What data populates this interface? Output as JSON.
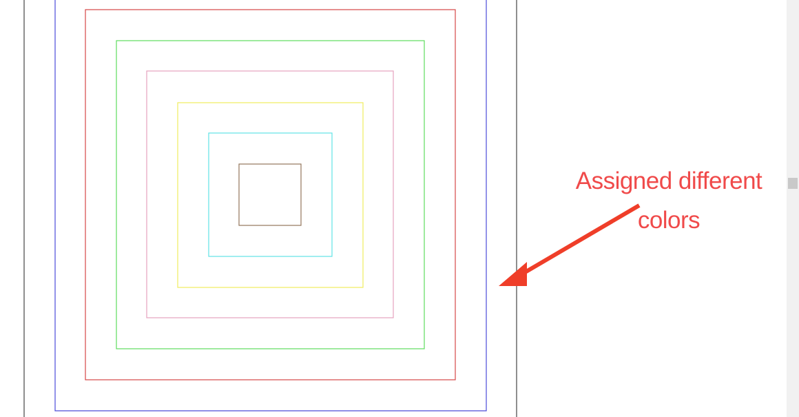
{
  "annotation": {
    "line1": "Assigned different",
    "line2": "colors",
    "color": "#f04a4a"
  },
  "squares": [
    {
      "name": "outer-frame",
      "color": "#444444"
    },
    {
      "name": "blue",
      "color": "#4a4ad8"
    },
    {
      "name": "red",
      "color": "#d64545"
    },
    {
      "name": "green",
      "color": "#5edc5e"
    },
    {
      "name": "pink",
      "color": "#e7a2bf"
    },
    {
      "name": "yellow",
      "color": "#f1ec5d"
    },
    {
      "name": "cyan",
      "color": "#5fe3e6"
    },
    {
      "name": "brown",
      "color": "#93765a"
    }
  ],
  "scrollbar": {
    "gutter_color": "#f1f1f1",
    "thumb_color": "#c9c9c9"
  }
}
